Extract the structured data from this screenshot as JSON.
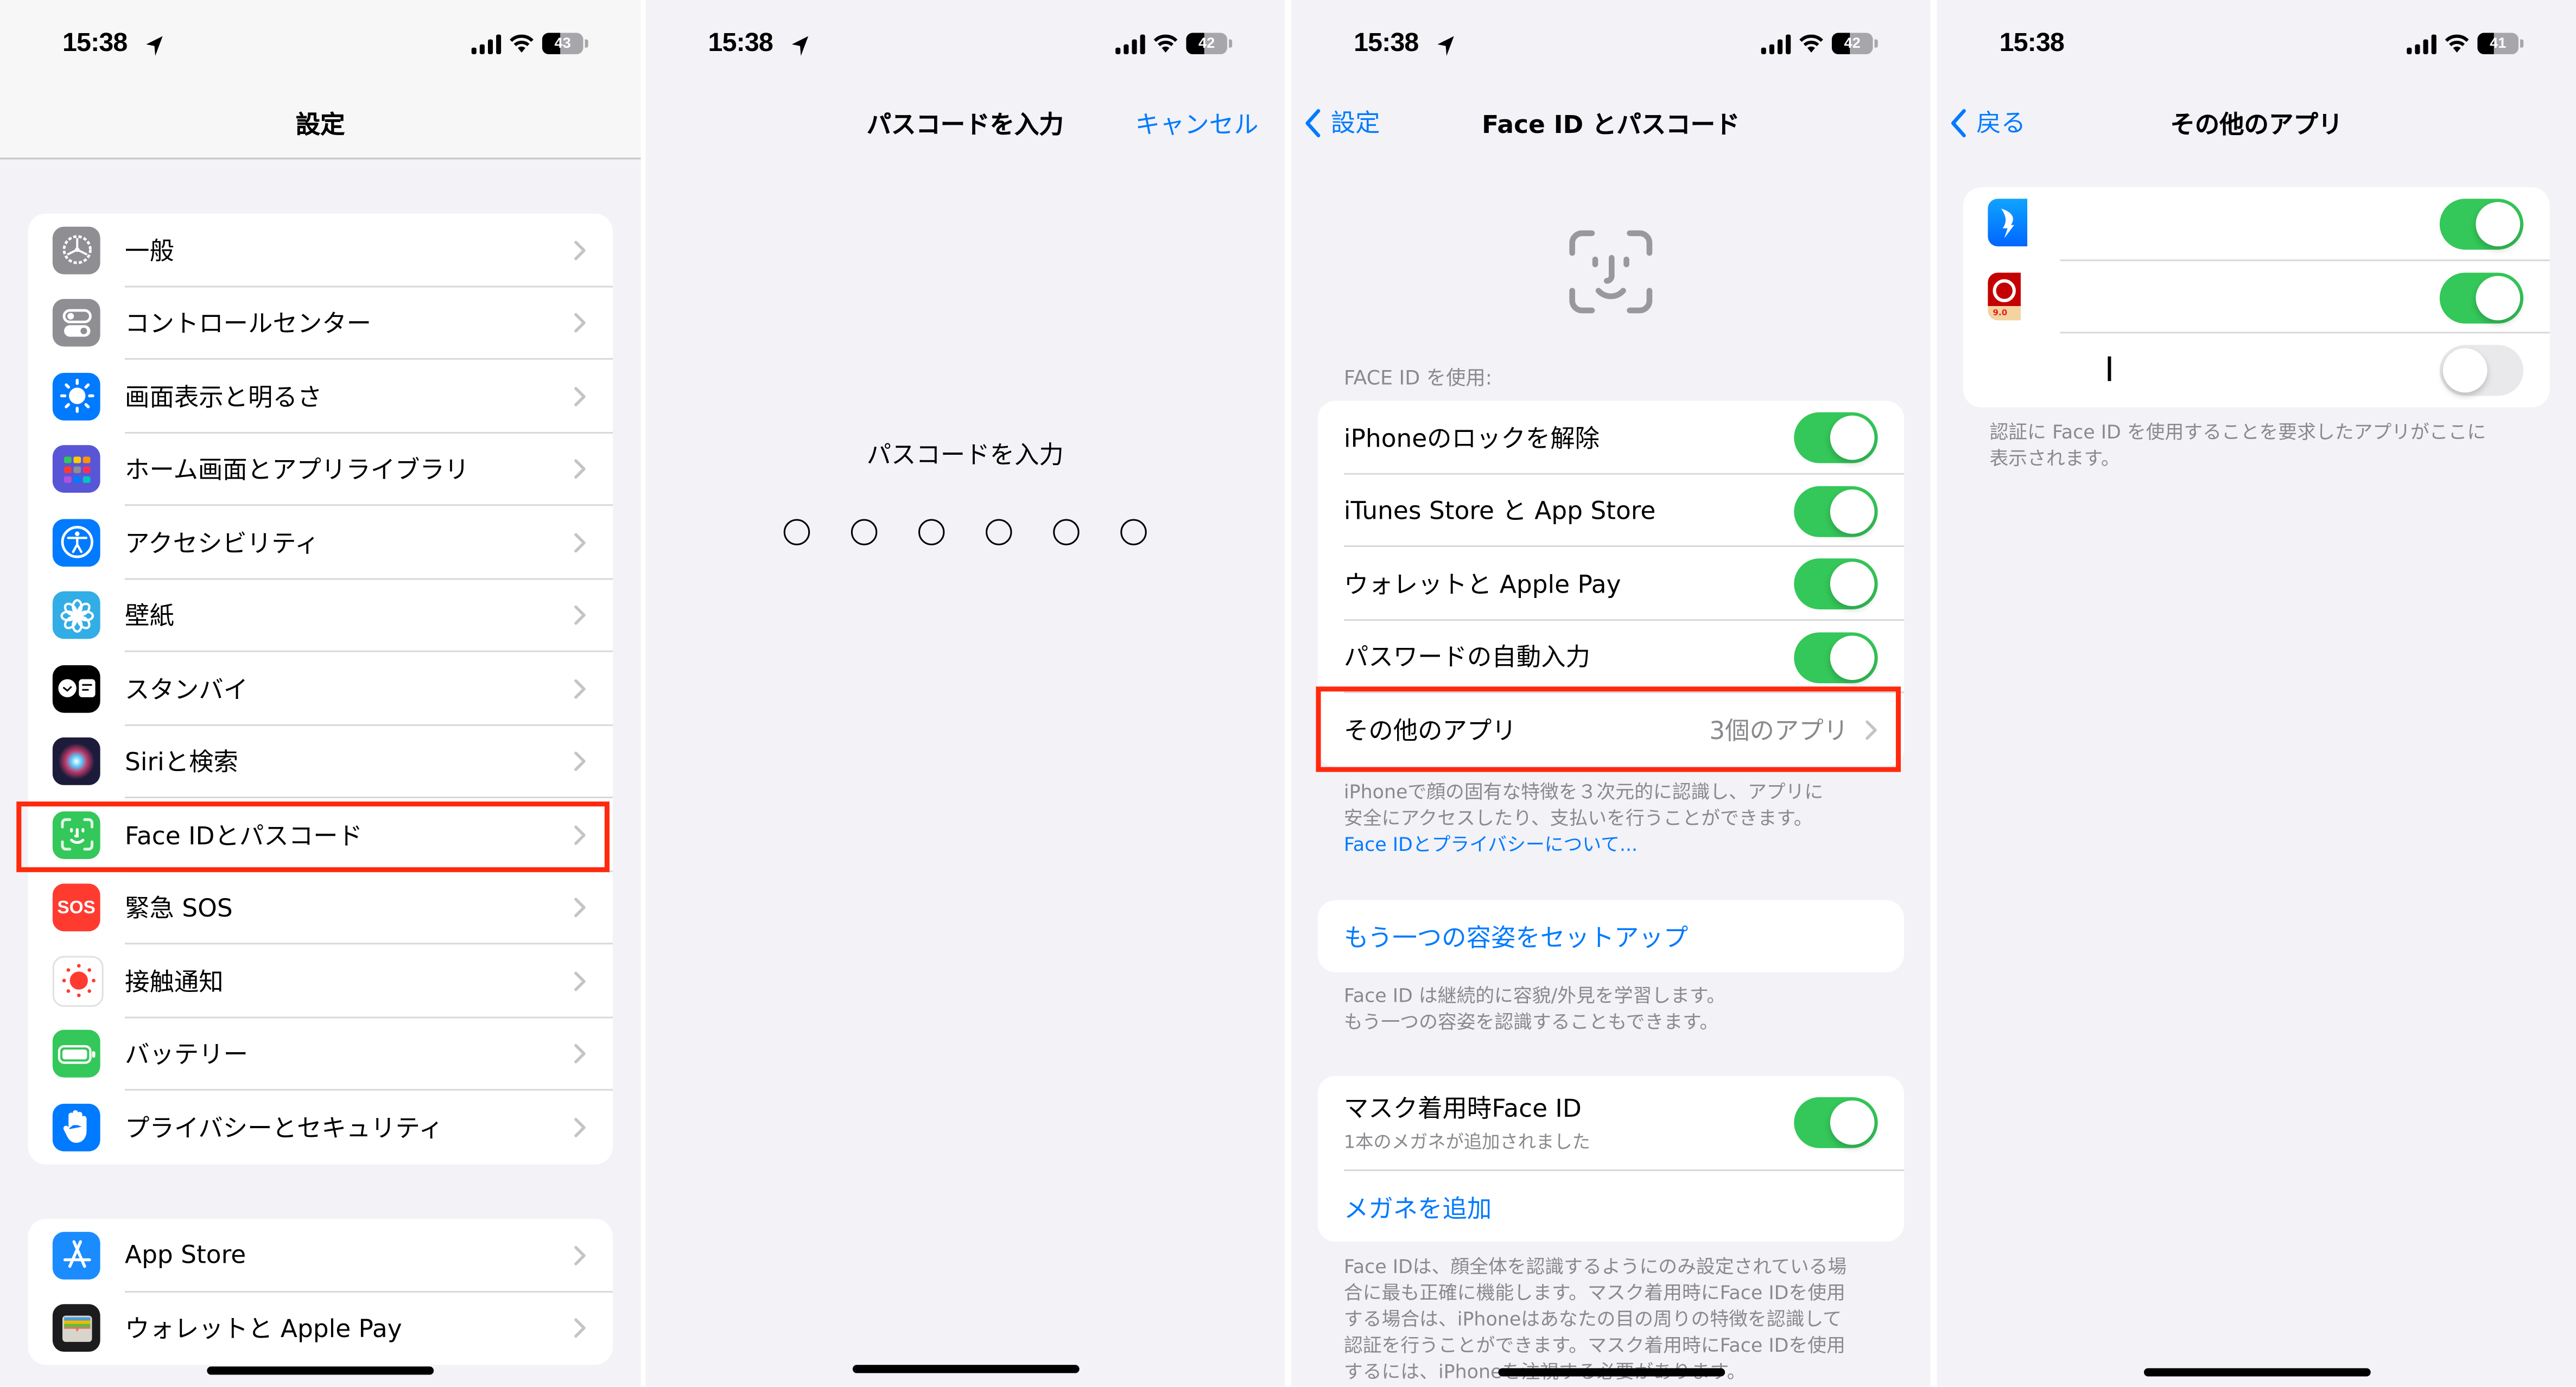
{
  "status_bars": [
    {
      "time": "15:38",
      "location_arrow": true,
      "battery": "43",
      "battery_level": 0.43
    },
    {
      "time": "15:38",
      "location_arrow": true,
      "battery": "42",
      "battery_level": 0.42
    },
    {
      "time": "15:38",
      "location_arrow": true,
      "battery": "42",
      "battery_level": 0.42
    },
    {
      "time": "15:38",
      "location_arrow": false,
      "battery": "41",
      "battery_level": 0.41
    }
  ],
  "settings": {
    "title": "設定",
    "group1": [
      {
        "label": "一般",
        "icon": "gear-icon",
        "color": "#8e8e93"
      },
      {
        "label": "コントロールセンター",
        "icon": "control-center-icon",
        "color": "#8e8e93"
      },
      {
        "label": "画面表示と明るさ",
        "icon": "brightness-icon",
        "color": "#007aff"
      },
      {
        "label": "ホーム画面とアプリライブラリ",
        "icon": "home-screen-icon",
        "color": "#5856d6"
      },
      {
        "label": "アクセシビリティ",
        "icon": "accessibility-icon",
        "color": "#007aff"
      },
      {
        "label": "壁紙",
        "icon": "wallpaper-icon",
        "color": "#32ade6"
      },
      {
        "label": "スタンバイ",
        "icon": "standby-icon",
        "color": "#000000"
      },
      {
        "label": "Siriと検索",
        "icon": "siri-icon",
        "color": "#1c1c3a"
      },
      {
        "label": "Face IDとパスコード",
        "icon": "face-id-icon",
        "color": "#34c759",
        "highlighted": true
      },
      {
        "label": "緊急 SOS",
        "icon": "sos-icon",
        "color": "#ff3b30",
        "icon_text": "SOS"
      },
      {
        "label": "接触通知",
        "icon": "exposure-notification-icon",
        "color": "#ffffff"
      },
      {
        "label": "バッテリー",
        "icon": "battery-icon",
        "color": "#34c759"
      },
      {
        "label": "プライバシーとセキュリティ",
        "icon": "privacy-hand-icon",
        "color": "#007aff"
      }
    ],
    "group2": [
      {
        "label": "App Store",
        "icon": "app-store-icon",
        "color": "#1a8cff"
      },
      {
        "label": "ウォレットと Apple Pay",
        "icon": "wallet-icon",
        "color": "#1c1c1e"
      }
    ]
  },
  "passcode": {
    "title": "パスコードを入力",
    "cancel": "キャンセル",
    "prompt": "パスコードを入力",
    "digit_count": 6,
    "digits_entered": 0
  },
  "faceid": {
    "back": "設定",
    "title": "Face ID とパスコード",
    "section_header": "FACE ID を使用:",
    "toggles": [
      {
        "label": "iPhoneのロックを解除",
        "on": true
      },
      {
        "label": "iTunes Store と App Store",
        "on": true
      },
      {
        "label": "ウォレットと Apple Pay",
        "on": true
      },
      {
        "label": "パスワードの自動入力",
        "on": true
      }
    ],
    "other_apps": {
      "label": "その他のアプリ",
      "value": "3個のアプリ",
      "highlighted": true
    },
    "footer1_line1": "iPhoneで顔の固有な特徴を３次元的に認識し、アプリに",
    "footer1_line2": "安全にアクセスしたり、支払いを行うことができます。",
    "footer1_link": "Face IDとプライバシーについて...",
    "alt_appearance": "もう一つの容姿をセットアップ",
    "footer2_line1": "Face ID は継続的に容貌/外見を学習します。",
    "footer2_line2": "もう一つの容姿を認識することもできます。",
    "mask_label": "マスク着用時Face ID",
    "mask_sub": "1本のメガネが追加されました",
    "mask_on": true,
    "add_glasses": "メガネを追加",
    "footer3": [
      "Face IDは、顔全体を認識するようにのみ設定されている場",
      "合に最も正確に機能します。マスク着用時にFace IDを使用",
      "する場合は、iPhoneはあなたの目の周りの特徴を認識して",
      "認証を行うことができます。マスク着用時にFace IDを使用",
      "するには、iPhoneを注視する必要があります。"
    ]
  },
  "other_apps": {
    "back": "戻る",
    "title": "その他のアプリ",
    "apps": [
      {
        "icon": "blue-wing-app-icon",
        "on": true
      },
      {
        "icon": "red-bank-app-icon",
        "on": true,
        "icon_text": "9.0"
      },
      {
        "icon": "text-cursor",
        "on": false
      }
    ],
    "footer_line1": "認証に Face ID を使用することを要求したアプリがここに",
    "footer_line2": "表示されます。"
  },
  "colors": {
    "accent": "#007aff",
    "toggle_on": "#34c759",
    "highlight": "#ff2a0e",
    "background": "#f2f2f7"
  }
}
